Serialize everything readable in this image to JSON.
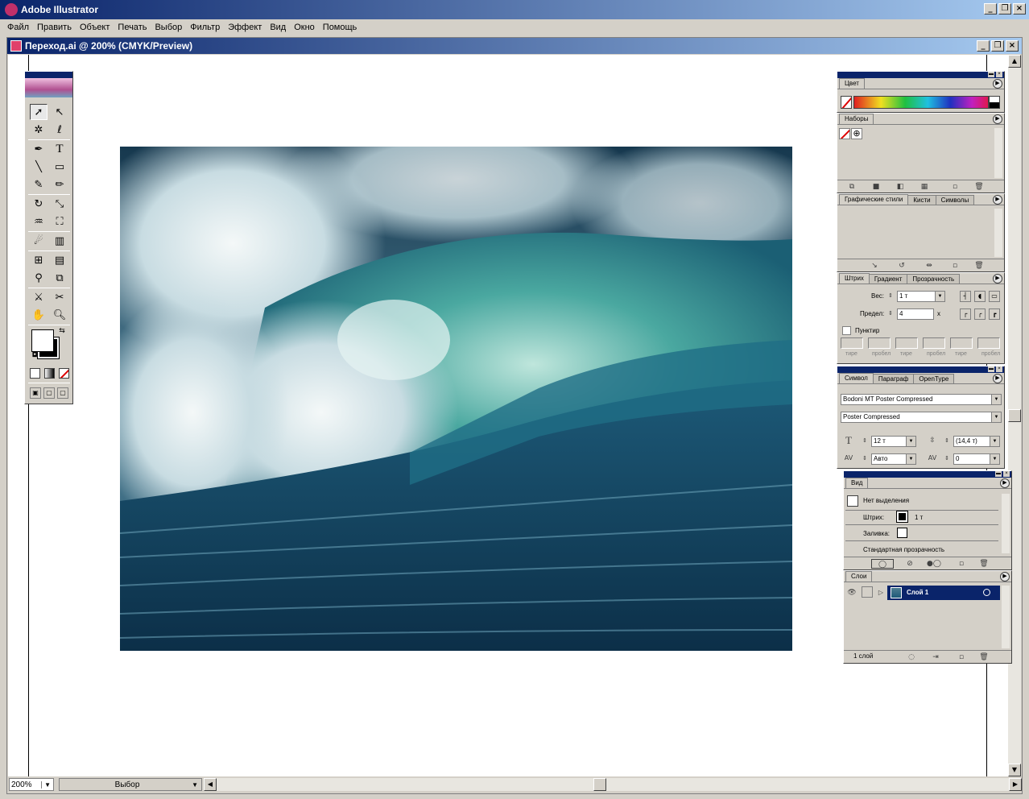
{
  "app": {
    "title": "Adobe Illustrator"
  },
  "menu": [
    "Файл",
    "Править",
    "Объект",
    "Печать",
    "Выбор",
    "Фильтр",
    "Эффект",
    "Вид",
    "Окно",
    "Помощь"
  ],
  "document": {
    "title": "Переход.ai @ 200% (CMYK/Preview)"
  },
  "status": {
    "zoom": "200%",
    "mode": "Выбор"
  },
  "panels": {
    "color": {
      "tab": "Цвет"
    },
    "swatches": {
      "tab": "Наборы"
    },
    "styles": {
      "tabs": [
        "Графические стили",
        "Кисти",
        "Символы"
      ]
    },
    "stroke": {
      "tabs": [
        "Штрих",
        "Градиент",
        "Прозрачность"
      ],
      "weight_label": "Вес:",
      "weight_value": "1 т",
      "limit_label": "Предел:",
      "limit_value": "4",
      "limit_unit": "x",
      "dashed_label": "Пунктир",
      "dash_labels": [
        "тире",
        "пробел",
        "тире",
        "пробел",
        "тире",
        "пробел"
      ]
    },
    "character": {
      "tabs": [
        "Символ",
        "Параграф",
        "OpenType"
      ],
      "font_family": "Bodoni MT Poster Compressed",
      "font_style": "Poster Compressed",
      "size": "12 т",
      "leading": "(14,4 т)",
      "kerning": "Авто",
      "tracking": "0"
    },
    "appearance": {
      "tab": "Вид",
      "no_selection": "Нет выделения",
      "stroke_label": "Штрих:",
      "stroke_value": "1 т",
      "fill_label": "Заливка:",
      "opacity_label": "Стандартная прозрачность"
    },
    "layers": {
      "tab": "Слои",
      "layer_name": "Слой 1",
      "count": "1 слой"
    }
  },
  "colors": {
    "title_active": "#0a246a",
    "layer_selected": "#0a246a",
    "chrome": "#d4d0c8"
  }
}
